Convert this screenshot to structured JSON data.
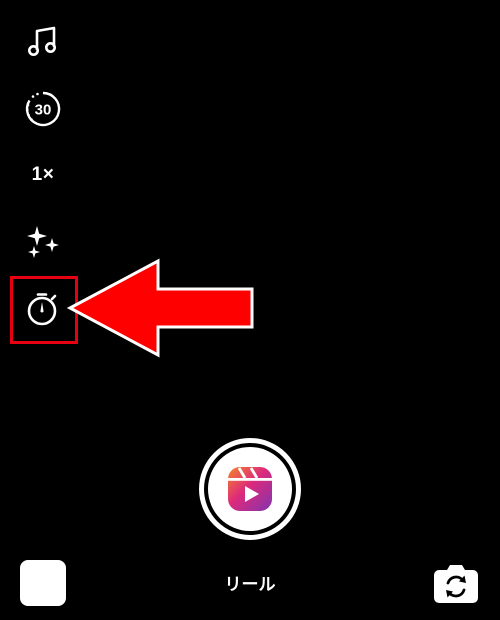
{
  "tools": {
    "music": {
      "icon": "music-note-icon"
    },
    "length": {
      "icon": "length-30-icon",
      "label": "30"
    },
    "speed": {
      "icon": "speed-icon",
      "label": "1×"
    },
    "effects": {
      "icon": "sparkles-icon"
    },
    "timer": {
      "icon": "timer-icon"
    }
  },
  "annotation": {
    "highlight_color": "#e60012",
    "arrow_color": "#ff0000"
  },
  "shutter": {
    "icon": "reels-icon"
  },
  "mode_label": "リール",
  "gallery": {
    "icon": "gallery-thumbnail"
  },
  "flip": {
    "icon": "flip-camera-icon"
  }
}
